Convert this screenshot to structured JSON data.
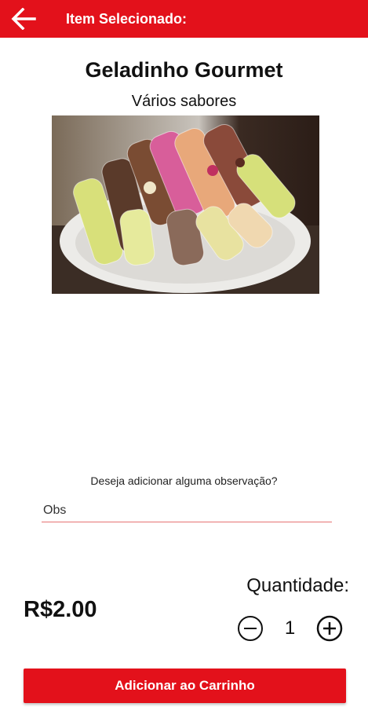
{
  "header": {
    "title": "Item Selecionado:",
    "back_icon": "arrow-left-icon",
    "background_color": "#e3111b"
  },
  "product": {
    "name": "Geladinho Gourmet",
    "subtitle": "Vários sabores",
    "image_icon": "product-photo"
  },
  "observation": {
    "question": "Deseja adicionar alguma observação?",
    "placeholder": "Obs",
    "value": ""
  },
  "price": {
    "currency": "R$",
    "amount": "2.00"
  },
  "quantity": {
    "label": "Quantidade:",
    "value": "1",
    "minus_icon": "minus-circle-icon",
    "plus_icon": "plus-circle-icon"
  },
  "actions": {
    "add_to_cart_label": "Adicionar ao Carrinho"
  }
}
